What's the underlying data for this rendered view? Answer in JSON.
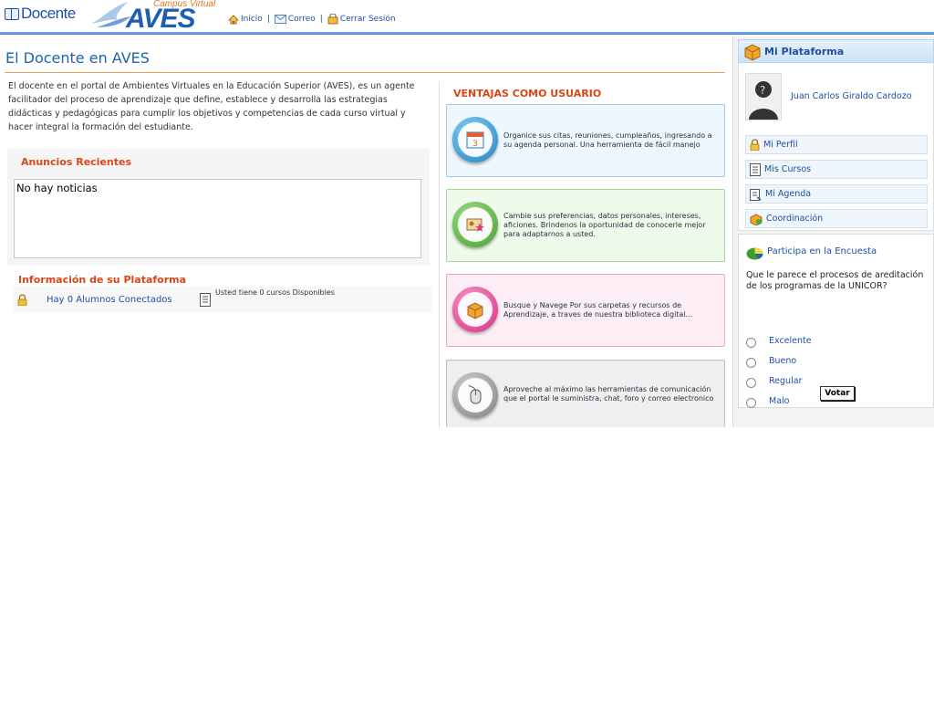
{
  "header": {
    "logo_docente": "Docente",
    "logo_campus": "Campus Virtual",
    "logo_aves": "AVES",
    "nav": [
      {
        "label": "Inicio",
        "icon": "home-icon"
      },
      {
        "label": "Correo",
        "icon": "mail-icon"
      },
      {
        "label": "Cerrar Sesión",
        "icon": "logout-icon"
      }
    ],
    "separator": "|"
  },
  "main": {
    "title": "El Docente en AVES",
    "intro": "El docente en el portal de Ambientes Virtuales en la Educación Superior (AVES), es un agente facilitador del proceso de aprendizaje que define, establece y desarrolla las estrategias didácticas y pedagógicas para cumplir los objetivos y competencias de cada curso virtual y hacer integral la formación del estudiante.",
    "anuncios": {
      "title": "Anuncios Recientes",
      "content": "No hay noticias"
    },
    "info": {
      "title": "Información de su Plataforma",
      "alumnos": "Hay 0 Alumnos Conectados",
      "cursos": "Usted tiene 0 cursos Disponibles"
    },
    "ventajas": {
      "title": "VENTAJAS COMO USUARIO",
      "cards": [
        {
          "text": "Organice sus citas, reuniones, cumpleaños, ingresando a su agenda personal. Una herramienta de fácil manejo",
          "icon": "calendar-icon"
        },
        {
          "text": "Cambie sus preferencias, datos personales, intereses, aficiones. Brindenos la oportunidad de conocerle mejor para adaptarnos a usted.",
          "icon": "profile-star-icon"
        },
        {
          "text": "Busque y Navege Por sus carpetas y recursos de Aprendizaje, a traves de nuestra biblioteca digital...",
          "icon": "package-icon"
        },
        {
          "text": "Aproveche al máximo las herramientas de comunicación que el portal le suministra, chat, foro y correo electronico",
          "icon": "mouse-icon"
        }
      ]
    }
  },
  "sidebar": {
    "title": "Mi Plataforma",
    "user_name": "Juan Carlos Giraldo Cardozo",
    "menu": [
      {
        "label": "Mi Perfil",
        "icon": "lock-icon"
      },
      {
        "label": "Mis Cursos",
        "icon": "document-icon"
      },
      {
        "label": "Mi Agenda",
        "icon": "agenda-icon"
      },
      {
        "label": "Coordinación",
        "icon": "coordination-icon"
      }
    ],
    "encuesta": {
      "title": "Participa en la Encuesta",
      "question": "Que le parece el procesos de areditación de los programas de la UNICOR?",
      "options": [
        "Excelente",
        "Bueno",
        "Regular",
        "Malo"
      ],
      "button": "Votar"
    }
  }
}
